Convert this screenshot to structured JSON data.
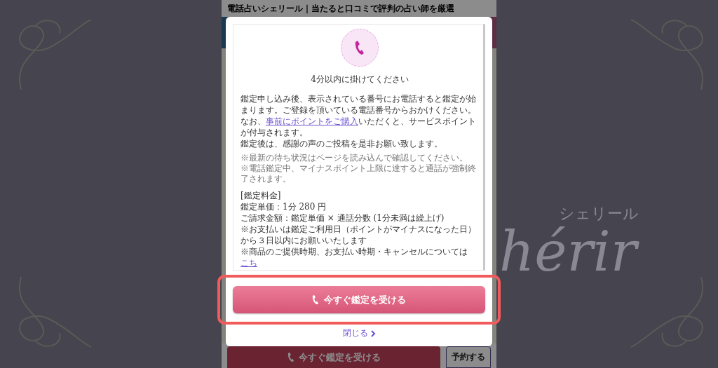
{
  "page_title": "電話占いシェリール｜当たると口コミで評判の占い師を厳選",
  "background_logo": {
    "script": "hérir",
    "kana": "シェリール"
  },
  "modal": {
    "heading": "4分以内に掛けてください",
    "paragraphs": [
      [
        {
          "kind": "text",
          "text": "鑑定申し込み後、表示されている番号にお電話すると鑑定が始まります。ご登録を頂いている電話番号からおかけください。"
        }
      ],
      [
        {
          "kind": "text",
          "text": "なお、"
        },
        {
          "kind": "link",
          "text": "事前にポイントをご購入"
        },
        {
          "kind": "text",
          "text": "いただくと、サービスポイントが付与されます。"
        }
      ],
      [
        {
          "kind": "text",
          "text": "鑑定後は、感謝の声のご投稿を是非お願い致します。"
        }
      ]
    ],
    "notes": [
      "※最新の待ち状況はページを読み込んで確認してください。",
      "※電話鑑定中、マイナスポイント上限に達すると通話が強制終了されます。"
    ],
    "fee_lines": [
      [
        {
          "kind": "text",
          "text": "[鑑定料金]"
        }
      ],
      [
        {
          "kind": "text",
          "text": "鑑定単価：1分 280 円"
        }
      ],
      [
        {
          "kind": "text",
          "text": "ご請求金額：鑑定単価 × 通話分数 (1分未満は繰上げ)"
        }
      ],
      [
        {
          "kind": "text",
          "text": "※お支払いは鑑定ご利用日（ポイントがマイナスになった日）から３日以内にお願いいたします"
        }
      ],
      [
        {
          "kind": "text",
          "text": "※商品のご提供時期、お支払い時期・キャンセルについては"
        },
        {
          "kind": "link",
          "text": "こち"
        }
      ]
    ],
    "call_button": "今すぐ鑑定を受ける",
    "close_link": "閉じる"
  },
  "bottom_bar": {
    "call_button": "今すぐ鑑定を受ける",
    "reserve_button": "予約する"
  }
}
